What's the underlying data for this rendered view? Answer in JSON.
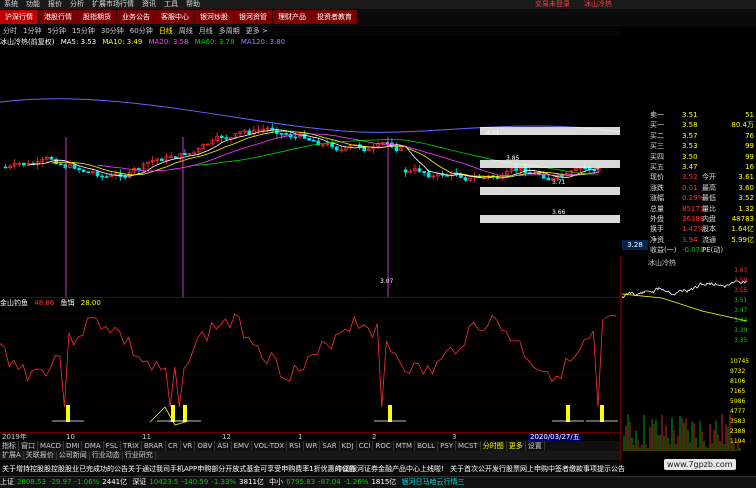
{
  "menu": [
    "系统",
    "功能",
    "报价",
    "分析",
    "扩展市场行情",
    "资讯",
    "工具",
    "帮助"
  ],
  "menu_red": [
    "交易未登录",
    "冰山冷热"
  ],
  "tabs": [
    "沪深行情",
    "港股行情",
    "股指期货",
    "业务公告",
    "客服中心",
    "银河炒股",
    "银河资管",
    "理财产品",
    "投资者教育"
  ],
  "periods": [
    "分时",
    "1分钟",
    "5分钟",
    "15分钟",
    "30分钟",
    "60分钟",
    "日线",
    "周线",
    "月线",
    "多周期",
    "更多 >"
  ],
  "period_selected": "日线",
  "ma_line": {
    "title": "冰山冷热(前复权)",
    "ma5": "MA5: 3.53",
    "ma10": "MA10: 3.49",
    "ma20": "MA20: 3.58",
    "ma60": "MA60: 3.78",
    "ma120": "MA120: 3.80"
  },
  "chart_annotations": [
    "4.01",
    "3.85",
    "3.71",
    "3.66",
    "3.07"
  ],
  "indicator_head": {
    "name": "金山钓鱼",
    "v1": "48.86",
    "label": "鱼饵",
    "v2": "28.00"
  },
  "indicator_scale": [
    "80.00",
    "60.00",
    "40.00",
    "20.00"
  ],
  "dates": [
    "2019年",
    "10",
    "11",
    "12",
    "1",
    "2",
    "3",
    "2020/03/27/五"
  ],
  "bottom_tabs": [
    "指标",
    "窗口",
    "MACD",
    "DMI",
    "DMA",
    "FSL",
    "TRIX",
    "BRAR",
    "CR",
    "VR",
    "OBV",
    "ASI",
    "EMV",
    "VOL-TDX",
    "RSI",
    "WR",
    "SAR",
    "KDJ",
    "CCI",
    "ROC",
    "MTM",
    "BOLL",
    "PSY",
    "MCST",
    "分时图",
    "更多",
    "设置"
  ],
  "bottom_tabs2": [
    "扩展A",
    "关联报价",
    "公司新闻",
    "行业动态",
    "行业研究"
  ],
  "news": [
    "关于增持控股股控股股业已完成功的公告",
    "关于通过我司手机APP申购部分开放式基金可享受申购费率1折优惠的公告",
    "中国银河证券金融产品中心上线啦!",
    "关于首次公开发行股票网上申购中签者缴款事项提示公告"
  ],
  "status": {
    "sh": "上证",
    "sh_v": "2808.53",
    "sh_c": "-29.97",
    "sh_p": "-1.06%",
    "sh_a": "2441亿",
    "sz": "深证",
    "sz_v": "10423.5",
    "sz_c": "-140.59",
    "sz_p": "-1.33%",
    "sz_a": "3811亿",
    "cy": "中小",
    "cy_v": "6795.83",
    "cy_c": "-87.04",
    "cy_p": "-1.26%",
    "cy_a": "1815亿",
    "info": "银河日马哈云行情三"
  },
  "quote": {
    "rows": [
      {
        "l": "卖一",
        "v": "3.51",
        "n": "51"
      },
      {
        "l": "买一",
        "v": "3.58",
        "n": "80.4万"
      },
      {
        "l": "买二",
        "v": "3.57",
        "n": "76"
      },
      {
        "l": "买三",
        "v": "3.53",
        "n": "99"
      },
      {
        "l": "买四",
        "v": "3.50",
        "n": "99"
      },
      {
        "l": "买五",
        "v": "3.47",
        "n": "16"
      },
      {
        "l": "现价",
        "v": "3.52",
        "l2": "今开",
        "n": "3.61"
      },
      {
        "l": "涨跌",
        "v": "0.01",
        "l2": "最高",
        "n": "3.60"
      },
      {
        "l": "涨幅",
        "v": "0.29%",
        "l2": "最低",
        "n": "3.52"
      },
      {
        "l": "总量",
        "v": "85171",
        "l2": "量比",
        "n": "1.32"
      },
      {
        "l": "外盘",
        "v": "36388",
        "l2": "内盘",
        "n": "48783"
      },
      {
        "l": "换手",
        "v": "1.42%",
        "l2": "股本",
        "n": "1.64亿"
      },
      {
        "l": "净资",
        "v": "3.94",
        "l2": "流通",
        "n": "5.99亿"
      },
      {
        "l": "收益(一)",
        "v": "-0.070",
        "l2": "PE(动)",
        "n": ""
      }
    ]
  },
  "price_box": "3.28",
  "mini": {
    "title": "冰山冷热",
    "scale": [
      "3.63",
      "3.59",
      "3.55",
      "3.51",
      "3.47",
      "3.43",
      "3.39",
      "3.35"
    ],
    "vol": [
      "10745",
      "9732",
      "8106",
      "7165",
      "5986",
      "4777",
      "3583",
      "2388",
      "1194"
    ]
  },
  "watermark": "www.7gpzb.com"
}
